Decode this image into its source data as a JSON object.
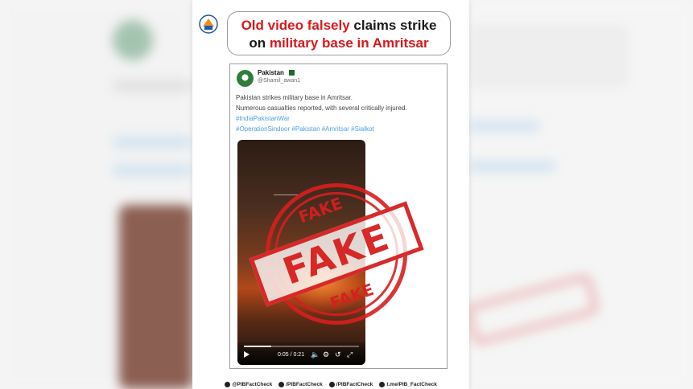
{
  "headline": {
    "line1_red": "Old video falsely",
    "line1_black": " claims strike",
    "line2_black": "on ",
    "line2_red": "military base in Amritsar"
  },
  "tweet": {
    "name": "Pakistan",
    "handle": "@Shamil_awan1",
    "line1": "Pakistan strikes military base in Amritsar.",
    "line2": "Numerous casualties reported, with several critically injured.",
    "tag_line1": "#IndiaPakistanWar",
    "tag_line2": "#OperationSindoor #Pakistan #Amritsar #Sialkot"
  },
  "video": {
    "time": "0:05 / 0:21",
    "progress": 0.24
  },
  "stamp": {
    "top": "FAKE",
    "middle": "FAKE",
    "bottom": "FAKE"
  },
  "footer": [
    {
      "icon": "x-icon",
      "text": "@PIBFactCheck"
    },
    {
      "icon": "threads-icon",
      "text": "/PIBFactCheck"
    },
    {
      "icon": "facebook-icon",
      "text": "/PIBFactCheck"
    },
    {
      "icon": "telegram-icon",
      "text": "t.me/PIB_FactCheck"
    }
  ],
  "colors": {
    "accent_red": "#d7191c",
    "hashtag_blue": "#4ea0e0",
    "stamp_red": "#d61f1f"
  }
}
